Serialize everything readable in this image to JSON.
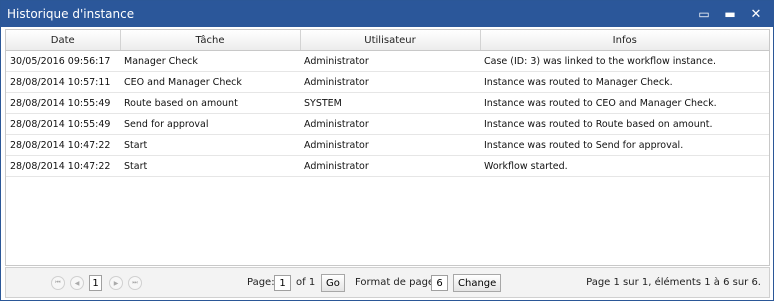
{
  "window": {
    "title": "Historique d'instance",
    "pin_icon": "▭",
    "minimize_icon": "▬",
    "close_icon": "✕"
  },
  "table": {
    "columns": [
      "Date",
      "Tâche",
      "Utilisateur",
      "Infos"
    ],
    "rows": [
      [
        "30/05/2016 09:56:17",
        "Manager Check",
        "Administrator",
        "Case (ID: 3) was linked to the workflow instance."
      ],
      [
        "28/08/2014 10:57:11",
        "CEO and Manager Check",
        "Administrator",
        "Instance was routed to Manager Check."
      ],
      [
        "28/08/2014 10:55:49",
        "Route based on amount",
        "SYSTEM",
        "Instance was routed to CEO and Manager Check."
      ],
      [
        "28/08/2014 10:55:49",
        "Send for approval",
        "Administrator",
        "Instance was routed to Route based on amount."
      ],
      [
        "28/08/2014 10:47:22",
        "Start",
        "Administrator",
        "Instance was routed to Send for approval."
      ],
      [
        "28/08/2014 10:47:22",
        "Start",
        "Administrator",
        "Workflow started."
      ]
    ]
  },
  "pager": {
    "first_icon": "⏮",
    "prev_icon": "◀",
    "current_page_button": "1",
    "next_icon": "▶",
    "last_icon": "⏭",
    "page_label": "Page:",
    "page_value": "1",
    "of_label": "of 1",
    "go_label": "Go",
    "format_label": "Format de page:",
    "format_value": "6",
    "change_label": "Change",
    "status": "Page 1 sur 1, éléments 1 à 6 sur 6."
  }
}
